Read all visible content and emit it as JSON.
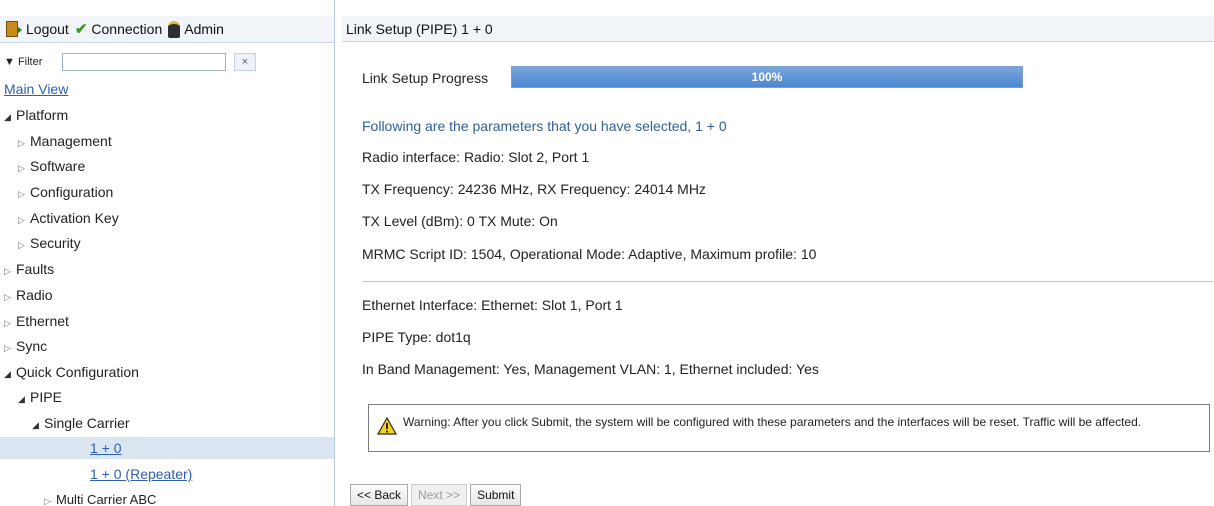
{
  "topbar": {
    "logout_label": "Logout",
    "connection_label": "Connection",
    "admin_label": "Admin"
  },
  "filter": {
    "label": "Filter",
    "value": "",
    "clear_symbol": "×"
  },
  "tree": {
    "main_view": "Main View",
    "platform": "Platform",
    "management": "Management",
    "software": "Software",
    "configuration": "Configuration",
    "activation_key": "Activation Key",
    "security": "Security",
    "faults": "Faults",
    "radio": "Radio",
    "ethernet": "Ethernet",
    "sync": "Sync",
    "quick_configuration": "Quick Configuration",
    "pipe": "PIPE",
    "single_carrier": "Single Carrier",
    "one_plus_zero": "1 + 0",
    "one_plus_zero_repeater": "1 + 0 (Repeater)",
    "multi_carrier_abc": "Multi Carrier ABC"
  },
  "main": {
    "title": "Link Setup (PIPE) 1 + 0",
    "progress_label": "Link Setup Progress",
    "progress_text": "100%",
    "progress_fraction": 1.0,
    "intro": "Following are the parameters that you have selected, 1 + 0",
    "radio_interface": "Radio interface: Radio: Slot 2, Port 1",
    "frequency": "TX Frequency: 24236 MHz, RX Frequency: 24014 MHz",
    "tx_level": "TX Level (dBm): 0 TX Mute: On",
    "mrmc": "MRMC Script ID: 1504, Operational Mode: Adaptive, Maximum profile: 10",
    "ethernet_interface": "Ethernet Interface: Ethernet: Slot 1, Port 1",
    "pipe_type": "PIPE Type: dot1q",
    "in_band": "In Band Management: Yes, Management VLAN: 1, Ethernet included: Yes",
    "warning": "Warning: After you click Submit, the system will be configured with these parameters and the interfaces will be reset. Traffic will be affected."
  },
  "buttons": {
    "back": "<< Back",
    "next": "Next >>",
    "submit": "Submit"
  },
  "colors": {
    "accent": "#4d86cf",
    "link": "#2f5fb0",
    "selected_row": "#dbe5f1",
    "header_bg": "#f1f4f9"
  }
}
